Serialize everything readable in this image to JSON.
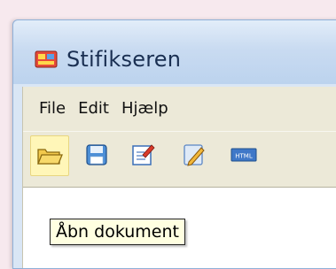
{
  "window": {
    "title": "Stifikseren"
  },
  "menubar": {
    "items": [
      {
        "label": "File"
      },
      {
        "label": "Edit"
      },
      {
        "label": "Hjælp"
      }
    ]
  },
  "toolbar": {
    "buttons": [
      {
        "icon": "folder-open-icon"
      },
      {
        "icon": "save-disk-icon"
      },
      {
        "icon": "edit-document-icon"
      },
      {
        "icon": "pencil-page-icon"
      },
      {
        "icon": "html-icon",
        "label": "HTML"
      }
    ]
  },
  "tooltip": {
    "text": "Åbn dokument"
  },
  "colors": {
    "titlebar_text": "#1a2f52",
    "tooltip_bg": "#ffffe1",
    "active_button_bg": "#fff6b8"
  }
}
